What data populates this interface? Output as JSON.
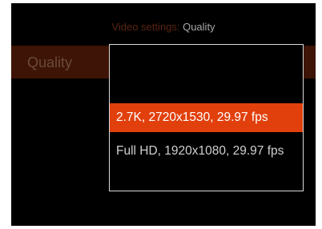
{
  "header": {
    "title_prefix": "Video settings:",
    "title_value": "Quality"
  },
  "setting": {
    "label": "Quality"
  },
  "dropdown": {
    "options": [
      {
        "label": "2.7K, 2720x1530, 29.97 fps",
        "selected": true
      },
      {
        "label": "Full HD, 1920x1080, 29.97 fps",
        "selected": false
      }
    ]
  },
  "colors": {
    "accent": "#e1400d",
    "row_highlight": "#3d1405",
    "background": "#000000",
    "border": "#d9d9d9"
  }
}
